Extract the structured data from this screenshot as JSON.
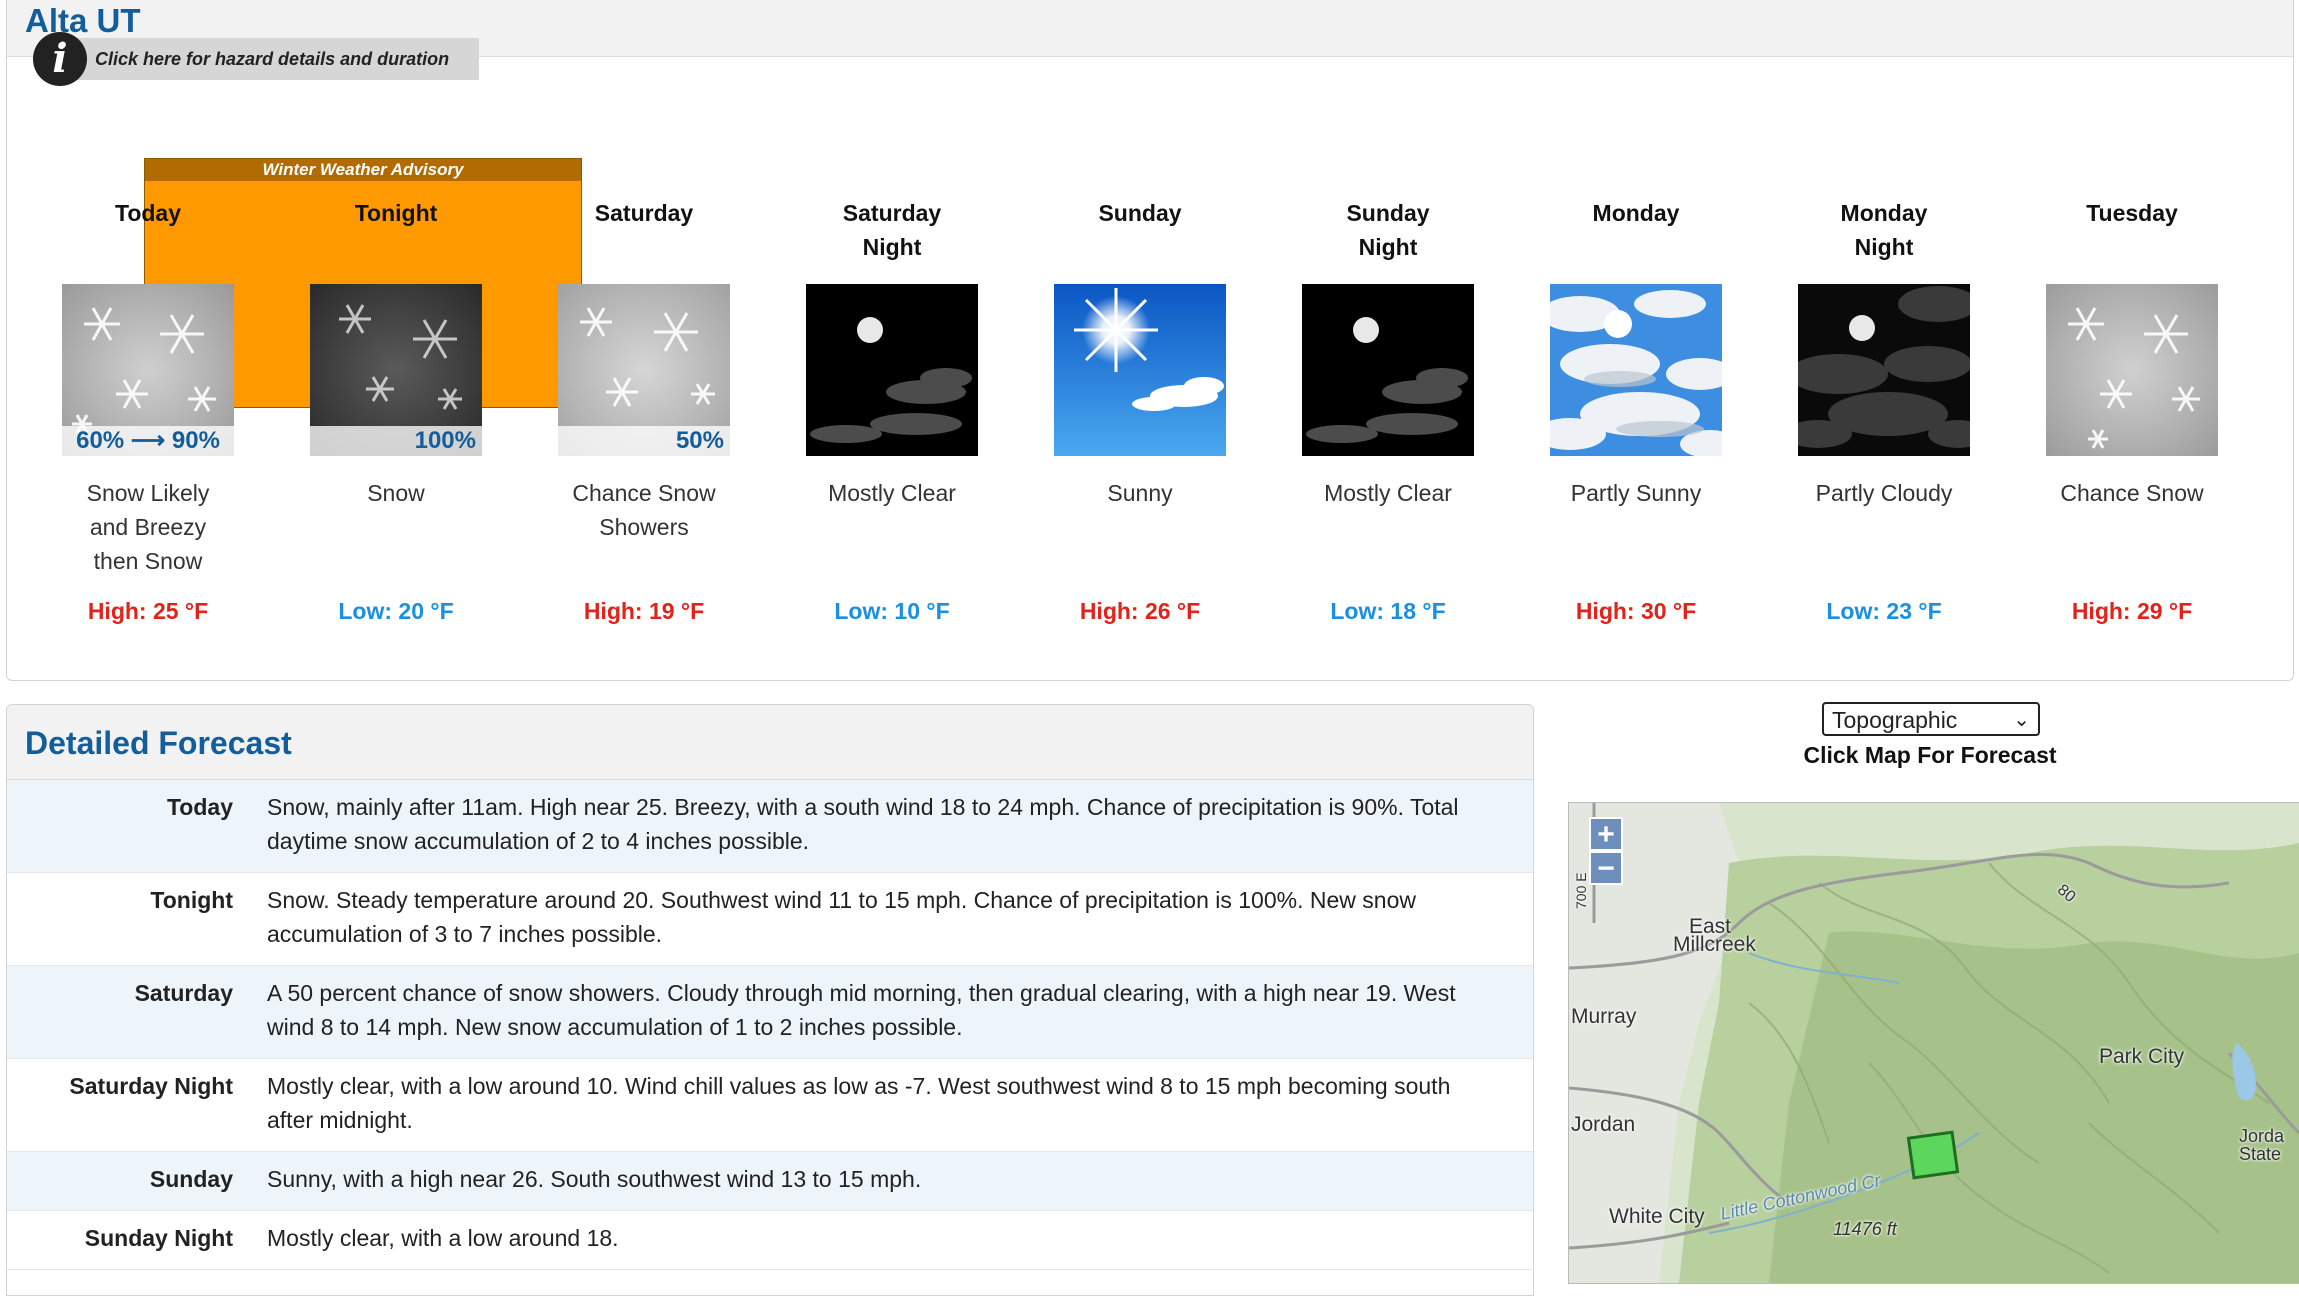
{
  "location": {
    "title": "Alta UT"
  },
  "hazard": {
    "link_text": "Click here for hazard details and duration",
    "advisory_label": "Winter Weather Advisory"
  },
  "periods": [
    {
      "name_line1": "Today",
      "name_line2": "",
      "icon": "snow-icon",
      "pop": "60% ⟶ 90%",
      "desc": [
        "Snow Likely",
        "and Breezy",
        "then Snow"
      ],
      "temp": "High: 25 °F",
      "kind": "high"
    },
    {
      "name_line1": "Tonight",
      "name_line2": "",
      "icon": "snow-night-icon",
      "pop": "100%",
      "desc": [
        "Snow",
        "",
        ""
      ],
      "temp": "Low: 20 °F",
      "kind": "low"
    },
    {
      "name_line1": "Saturday",
      "name_line2": "",
      "icon": "snow-showers-icon",
      "pop": "50%",
      "desc": [
        "Chance Snow",
        "Showers",
        ""
      ],
      "temp": "High: 19 °F",
      "kind": "high"
    },
    {
      "name_line1": "Saturday",
      "name_line2": "Night",
      "icon": "moon-clouds-icon",
      "pop": "",
      "desc": [
        "Mostly Clear",
        "",
        ""
      ],
      "temp": "Low: 10 °F",
      "kind": "low"
    },
    {
      "name_line1": "Sunday",
      "name_line2": "",
      "icon": "sun-icon",
      "pop": "",
      "desc": [
        "Sunny",
        "",
        ""
      ],
      "temp": "High: 26 °F",
      "kind": "high"
    },
    {
      "name_line1": "Sunday",
      "name_line2": "Night",
      "icon": "moon-clouds-icon",
      "pop": "",
      "desc": [
        "Mostly Clear",
        "",
        ""
      ],
      "temp": "Low: 18 °F",
      "kind": "low"
    },
    {
      "name_line1": "Monday",
      "name_line2": "",
      "icon": "partly-sunny-icon",
      "pop": "",
      "desc": [
        "Partly Sunny",
        "",
        ""
      ],
      "temp": "High: 30 °F",
      "kind": "high"
    },
    {
      "name_line1": "Monday",
      "name_line2": "Night",
      "icon": "moon-cloudy-icon",
      "pop": "",
      "desc": [
        "Partly Cloudy",
        "",
        ""
      ],
      "temp": "Low: 23 °F",
      "kind": "low"
    },
    {
      "name_line1": "Tuesday",
      "name_line2": "",
      "icon": "snow-icon",
      "pop": "",
      "desc": [
        "Chance Snow",
        "",
        ""
      ],
      "temp": "High: 29 °F",
      "kind": "high"
    }
  ],
  "detailed": {
    "title": "Detailed Forecast",
    "rows": [
      {
        "label": "Today",
        "text": "Snow, mainly after 11am. High near 25. Breezy, with a south wind 18 to 24 mph. Chance of precipitation is 90%. Total daytime snow accumulation of 2 to 4 inches possible."
      },
      {
        "label": "Tonight",
        "text": "Snow. Steady temperature around 20. Southwest wind 11 to 15 mph. Chance of precipitation is 100%. New snow accumulation of 3 to 7 inches possible."
      },
      {
        "label": "Saturday",
        "text": "A 50 percent chance of snow showers. Cloudy through mid morning, then gradual clearing, with a high near 19. West wind 8 to 14 mph. New snow accumulation of 1 to 2 inches possible."
      },
      {
        "label": "Saturday Night",
        "text": "Mostly clear, with a low around 10. Wind chill values as low as -7. West southwest wind 8 to 15 mph becoming south after midnight."
      },
      {
        "label": "Sunday",
        "text": "Sunny, with a high near 26. South southwest wind 13 to 15 mph."
      },
      {
        "label": "Sunday Night",
        "text": "Mostly clear, with a low around 18."
      }
    ]
  },
  "map": {
    "select_value": "Topographic",
    "caption": "Click Map For Forecast",
    "zoom_in": "+",
    "zoom_out": "−",
    "labels": {
      "east_millcreek_1": "East",
      "east_millcreek_2": "Millcreek",
      "murray": "Murray",
      "jordan": "Jordan",
      "white_city": "White City",
      "park_city": "Park City",
      "little_cottonwood": "Little Cottonwood Cr",
      "elevation": "11476 ft",
      "jordanelle_1": "Jorda",
      "jordanelle_2": "State",
      "hwy_80": "80",
      "road_700": "700 E"
    }
  },
  "colors": {
    "title_blue": "#135d9b",
    "advisory_orange": "#ff9900",
    "high_red": "#e2231a",
    "low_blue": "#1b90e0"
  }
}
